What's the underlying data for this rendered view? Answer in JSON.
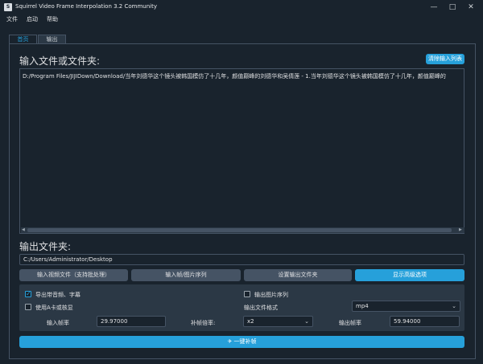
{
  "window": {
    "app_icon": "S",
    "title": "Squirrel Video Frame Interpolation 3.2 Community",
    "minimize": "—",
    "maximize": "□",
    "close": "✕"
  },
  "menu": [
    "文件",
    "启动",
    "帮助"
  ],
  "tabs": [
    {
      "label": "首页",
      "active": true
    },
    {
      "label": "输出",
      "active": false
    }
  ],
  "input_section": {
    "title": "输入文件或文件夹:",
    "clear_button": "清除输入列表",
    "files": [
      "D:/Program Files/JIJIDown/Download/当年刘德华这个镜头被韩国模仿了十几年，颜值巅峰的刘德华和吴倩莲 - 1.当年刘德华这个镜头被韩国模仿了十几年，颜值巅峰的"
    ],
    "scroll_left": "◀",
    "scroll_right": "▶"
  },
  "output_section": {
    "title": "输出文件夹:",
    "path": "C:/Users/Administrator/Desktop"
  },
  "buttons": {
    "input_video": "输入视频文件（支持批处理）",
    "input_frames": "输入帧/图片序列",
    "set_output": "设置输出文件夹",
    "advanced": "显示高级选项"
  },
  "options": {
    "export_audio_subs": {
      "label": "导出带音频、字幕",
      "checked": true
    },
    "use_amd": {
      "label": "使用A卡或核显",
      "checked": false
    },
    "output_image_seq": {
      "label": "输出图片序列",
      "checked": false
    },
    "output_format_label": "输出文件格式",
    "output_format": "mp4",
    "input_fps_label": "输入帧率",
    "input_fps": "29.97000",
    "multiplier_label": "补帧倍率:",
    "multiplier": "x2",
    "output_fps_label": "输出帧率",
    "output_fps": "59.94000",
    "check_glyph": "✓",
    "dropdown_glyph": "⌄"
  },
  "main_button": {
    "icon": "rocket-icon",
    "glyph": "✈",
    "label": "一键补帧"
  },
  "colors": {
    "accent": "#26a0da",
    "background": "#19232d",
    "panel": "#2b3845",
    "border": "#455364"
  }
}
